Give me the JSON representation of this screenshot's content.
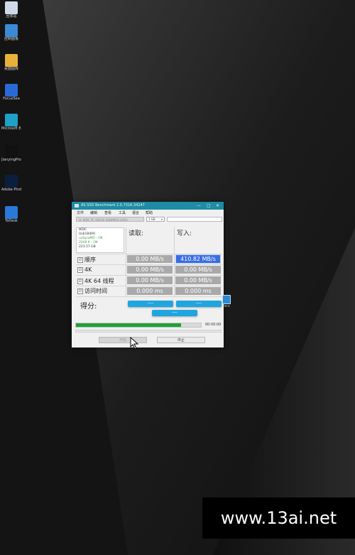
{
  "desktop": {
    "icons": [
      {
        "label": "回收站",
        "icon": "recycle-bin-icon",
        "color": "#cfd8e6"
      },
      {
        "label": "控制面板",
        "icon": "control-panel-icon",
        "color": "#3a8ad6"
      },
      {
        "label": "桌面图库",
        "icon": "folder-icon",
        "color": "#e8b23a"
      },
      {
        "label": "FocusSea",
        "icon": "focus-app-icon",
        "color": "#2a6ad6"
      },
      {
        "label": "Microsoft Edge",
        "icon": "edge-icon",
        "color": "#1ea0c8"
      },
      {
        "label": "JianyingPro",
        "icon": "jianying-icon",
        "color": "#111111"
      },
      {
        "label": "Adobe Photosh",
        "icon": "photoshop-icon",
        "color": "#0a1e3e"
      },
      {
        "label": "ToDesk",
        "icon": "todesk-icon",
        "color": "#2a78d8"
      }
    ],
    "file": {
      "label": "Benc",
      "icon": "file-icon"
    }
  },
  "window": {
    "title": "AS SSD Benchmark 2.0.7316.34247",
    "controls": {
      "minimize": "—",
      "maximize": "□",
      "close": "✕"
    },
    "menu": [
      "文件",
      "编辑",
      "查看",
      "工具",
      "语言",
      "帮助"
    ],
    "drive_select": "H: WDC PC SN530 SDBPNPZ-256G",
    "size_select": "1 GB",
    "drive_info": {
      "model": "WDC",
      "line2": "Usb1B400",
      "line3": "uaSpiuMD - OK",
      "line4": "2048 K - OK",
      "capacity": "223.57 GB"
    },
    "columns": {
      "read": "读取:",
      "write": "写入:"
    },
    "rows": [
      {
        "label": "顺序",
        "checked": true,
        "read": "0.00 MB/s",
        "write": "410.82 MB/s"
      },
      {
        "label": "4K",
        "checked": true,
        "read": "0.00 MB/s",
        "write": "0.00 MB/s"
      },
      {
        "label": "4K 64 线程",
        "checked": true,
        "read": "0.00 MB/s",
        "write": "0.00 MB/s"
      },
      {
        "label": "访问时间",
        "checked": true,
        "read": "0.000 ms",
        "write": "0.000 ms"
      }
    ],
    "score": {
      "label": "得分:",
      "read": "----",
      "write": "----",
      "total": "----"
    },
    "progress": {
      "fraction": 0.84,
      "elapsed": "00:00:00"
    },
    "buttons": {
      "start": "开始",
      "stop": "中止"
    }
  },
  "watermark": "www.13ai.net",
  "colors": {
    "titlebar": "#1e8ca4",
    "highlight": "#3a6ee0",
    "progress": "#1ea234",
    "score": "#1fa6e0"
  }
}
